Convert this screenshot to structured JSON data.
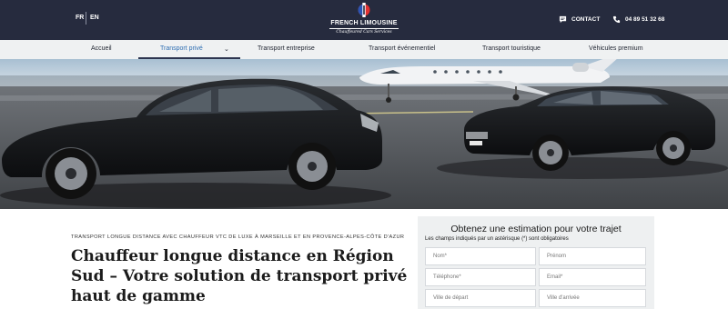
{
  "header": {
    "languages": [
      "FR",
      "EN"
    ],
    "logo": {
      "name": "FRENCH LIMOUSINE",
      "tagline": "Chauffeured Cars Services"
    },
    "contact_label": "CONTACT",
    "phone": "04 89 51 32 68",
    "icons": [
      "chat-icon",
      "phone-icon"
    ]
  },
  "nav": {
    "items": [
      "Accueil",
      "Transport privé",
      "Transport entreprise",
      "Transport événementiel",
      "Transport touristique",
      "Véhicules premium"
    ],
    "active_index": 1
  },
  "hero": {
    "image": "two black sedans parked on an airport apron in front of a private jet"
  },
  "main": {
    "subtitle": "Transport longue distance avec chauffeur VTC de luxe à Marseille et en Provence-Alpes-Côte d'Azur",
    "headline": "Chauffeur longue distance en Région Sud – Votre solution de transport privé haut de gamme"
  },
  "form": {
    "title": "Obtenez une estimation pour votre trajet",
    "note": "Les champs indiqués par un astérisque (*) sont obligatoires",
    "fields": {
      "nom": "Nom*",
      "prenom": "Prénom",
      "telephone": "Téléphone*",
      "email": "Email*",
      "depart": "Ville de départ",
      "arrivee": "Ville d'arrivée"
    }
  },
  "colors": {
    "header_bg": "#262b3e",
    "nav_bg": "#eff1f2",
    "active_link": "#2f6fb3",
    "form_bg": "#eef0f1"
  }
}
